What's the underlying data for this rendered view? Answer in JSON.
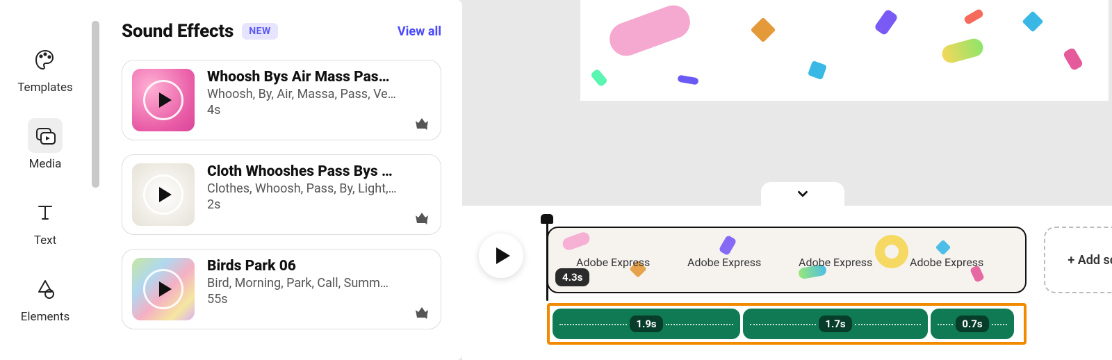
{
  "rail": {
    "items": [
      {
        "key": "templates",
        "label": "Templates"
      },
      {
        "key": "media",
        "label": "Media"
      },
      {
        "key": "text",
        "label": "Text"
      },
      {
        "key": "elements",
        "label": "Elements"
      }
    ],
    "active": "media"
  },
  "panel": {
    "title": "Sound Effects",
    "new_badge": "NEW",
    "view_all": "View all",
    "items": [
      {
        "title": "Whoosh Bys Air Mass Pas…",
        "tags": "Whoosh, By, Air, Massa, Pass, Ve…",
        "duration": "4s",
        "thumb": "pink",
        "premium": true
      },
      {
        "title": "Cloth Whooshes Pass Bys …",
        "tags": "Clothes, Whoosh, Pass, By, Light,…",
        "duration": "2s",
        "thumb": "light",
        "premium": true
      },
      {
        "title": "Birds Park 06",
        "tags": "Bird, Morning, Park, Call, Summ…",
        "duration": "55s",
        "thumb": "paint",
        "premium": true
      }
    ]
  },
  "timeline": {
    "play_label": "Play",
    "clip": {
      "duration": "4.3s",
      "watermark": "Adobe Express"
    },
    "audio_clips": [
      {
        "duration": "1.9s",
        "flex": 270
      },
      {
        "duration": "1.7s",
        "flex": 266
      },
      {
        "duration": "0.7s",
        "flex": 120
      }
    ],
    "add_scene": "+ Add scene"
  }
}
